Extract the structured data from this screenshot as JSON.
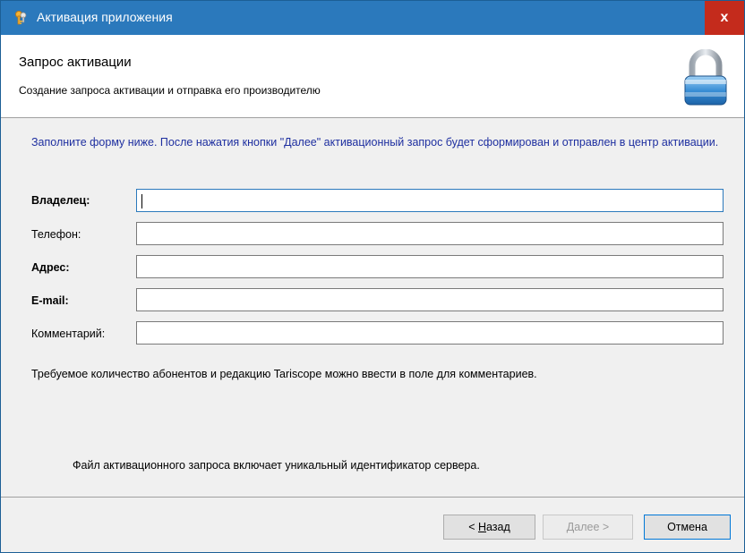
{
  "window": {
    "title": "Активация приложения",
    "close_label": "x"
  },
  "header": {
    "title": "Запрос активации",
    "subtitle": "Создание запроса активации и отправка его производителю"
  },
  "intro_text": "Заполните форму ниже. После нажатия кнопки \"Далее\" активационный запрос будет сформирован и отправлен в центр активации.",
  "form": {
    "owner": {
      "label": "Владелец:",
      "value": ""
    },
    "phone": {
      "label": "Телефон:",
      "value": ""
    },
    "address": {
      "label": "Адрес:",
      "value": ""
    },
    "email": {
      "label": "E-mail:",
      "value": ""
    },
    "comment": {
      "label": "Комментарий:",
      "value": ""
    }
  },
  "note_subscribers": "Требуемое количество абонентов и редакцию Tariscope можно ввести в поле для комментариев.",
  "note_identifier": "Файл активационного запроса включает уникальный идентификатор сервера.",
  "buttons": {
    "back_prefix": "< ",
    "back_access": "Н",
    "back_rest": "азад",
    "next_access": "Д",
    "next_rest": "алее >",
    "cancel": "Отмена"
  },
  "colors": {
    "titlebar": "#2b79bc",
    "close": "#c42b1c",
    "intro_text": "#1e2fa0"
  },
  "icons": {
    "title": "key-icon",
    "header": "padlock-icon"
  }
}
